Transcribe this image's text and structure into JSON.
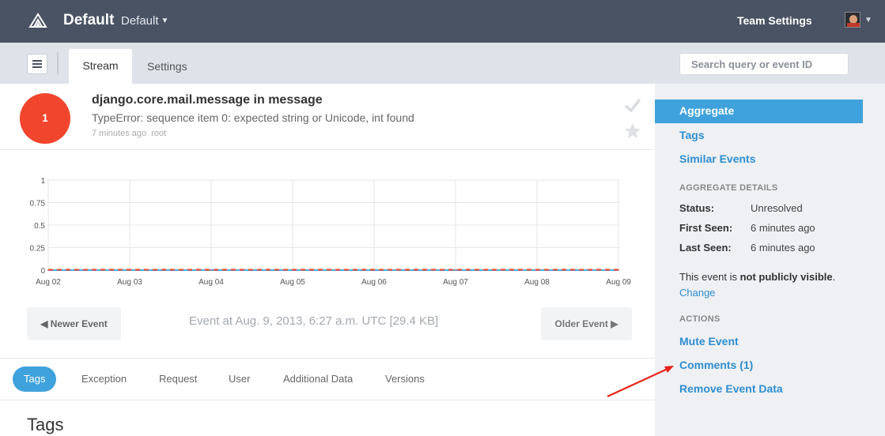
{
  "header": {
    "project_name": "Default",
    "project_dropdown": "Default",
    "team_settings": "Team Settings"
  },
  "subnav": {
    "tabs": [
      "Stream",
      "Settings"
    ],
    "search_placeholder": "Search query or event ID"
  },
  "event": {
    "count": "1",
    "title": "django.core.mail.message in message",
    "message": "TypeError: sequence item 0: expected string or Unicode, int found",
    "time_ago": "7 minutes ago",
    "user": "root"
  },
  "chart_data": {
    "type": "line",
    "x": [
      "Aug 02",
      "Aug 03",
      "Aug 04",
      "Aug 05",
      "Aug 06",
      "Aug 07",
      "Aug 08",
      "Aug 09"
    ],
    "series": [
      {
        "values": [
          0,
          0,
          0,
          0,
          0,
          0,
          0,
          0
        ],
        "color": "#4fa9e0"
      },
      {
        "values": [
          0,
          0,
          0,
          0,
          0,
          0,
          0,
          0
        ],
        "color": "#f1452d"
      }
    ],
    "y_ticks": [
      "1",
      "0.75",
      "0.5",
      "0.25",
      "0"
    ],
    "ylim": [
      0,
      1
    ],
    "grid": true
  },
  "event_nav": {
    "newer": "◀  Newer Event",
    "older": "Older Event  ▶",
    "event_at": "Event at Aug. 9, 2013, 6:27 a.m. UTC [29.4 KB]"
  },
  "detail_tabs": [
    "Tags",
    "Exception",
    "Request",
    "User",
    "Additional Data",
    "Versions"
  ],
  "section_heading": "Tags",
  "sidebar": {
    "links": [
      "Aggregate",
      "Tags",
      "Similar Events"
    ],
    "details_heading": "AGGREGATE DETAILS",
    "details": [
      {
        "key": "Status:",
        "value": "Unresolved"
      },
      {
        "key": "First Seen:",
        "value": "6 minutes ago"
      },
      {
        "key": "Last Seen:",
        "value": "6 minutes ago"
      }
    ],
    "visibility_prefix": "This event is ",
    "visibility_bold": "not publicly visible",
    "visibility_suffix": ".",
    "change": "Change",
    "actions_heading": "ACTIONS",
    "actions": [
      "Mute Event",
      "Comments (1)",
      "Remove Event Data"
    ]
  },
  "colors": {
    "topbar": "#4a5363",
    "accent": "#40a2dc",
    "count_badge": "#f1452d",
    "annotation_arrow": "#e8231b"
  }
}
